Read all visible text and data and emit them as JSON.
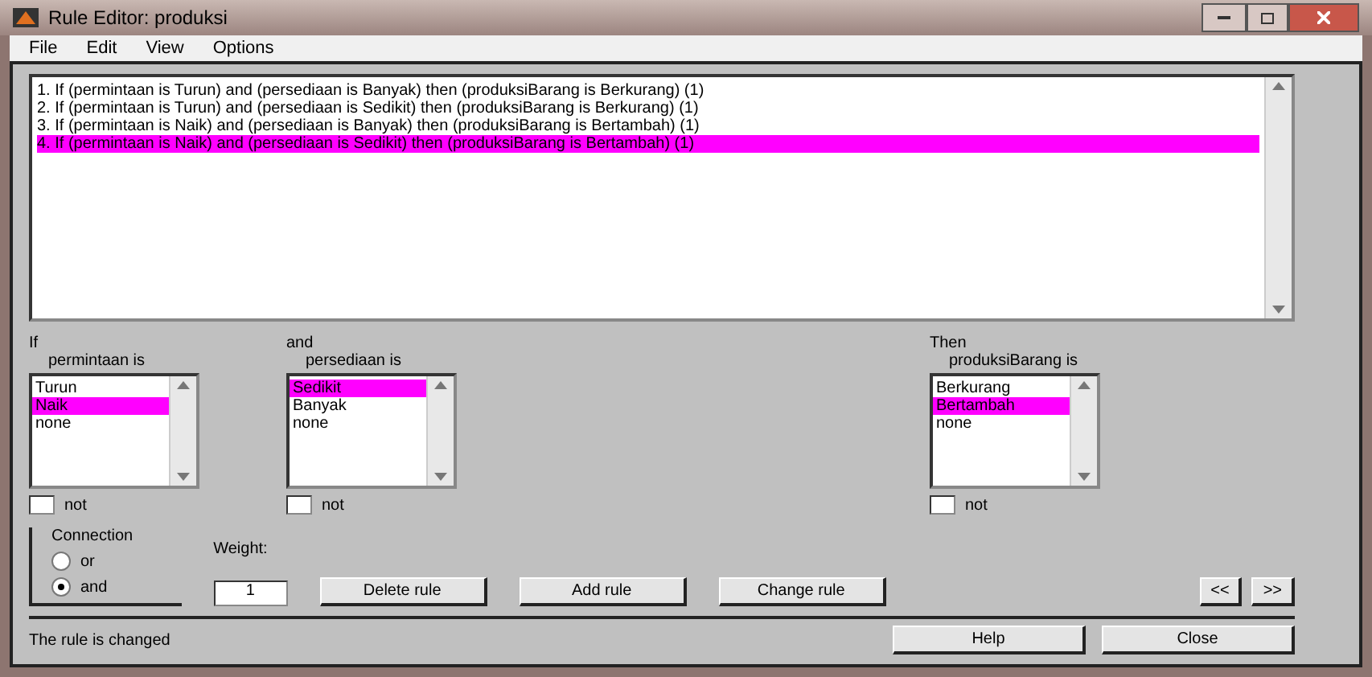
{
  "window": {
    "title": "Rule Editor: produksi"
  },
  "menu": [
    "File",
    "Edit",
    "View",
    "Options"
  ],
  "rules": [
    {
      "text": "1. If (permintaan is Turun) and (persediaan is Banyak) then (produksiBarang is Berkurang) (1)",
      "selected": false
    },
    {
      "text": "2. If (permintaan is Turun) and (persediaan is Sedikit) then (produksiBarang is Berkurang) (1)",
      "selected": false
    },
    {
      "text": "3. If (permintaan is Naik) and (persediaan is Banyak) then (produksiBarang is Bertambah) (1)",
      "selected": false
    },
    {
      "text": "4. If (permintaan is Naik) and (persediaan is Sedikit) then (produksiBarang is Bertambah) (1)",
      "selected": true
    }
  ],
  "variables": [
    {
      "prefix": "If",
      "name": "permintaan is",
      "items": [
        {
          "label": "Turun",
          "selected": false
        },
        {
          "label": "Naik",
          "selected": true
        },
        {
          "label": "none",
          "selected": false
        }
      ],
      "not_label": "not",
      "not_checked": false
    },
    {
      "prefix": "and",
      "name": "persediaan is",
      "items": [
        {
          "label": "Sedikit",
          "selected": true
        },
        {
          "label": "Banyak",
          "selected": false
        },
        {
          "label": "none",
          "selected": false
        }
      ],
      "not_label": "not",
      "not_checked": false
    },
    {
      "prefix": "Then",
      "name": "produksiBarang is",
      "items": [
        {
          "label": "Berkurang",
          "selected": false
        },
        {
          "label": "Bertambah",
          "selected": true
        },
        {
          "label": "none",
          "selected": false
        }
      ],
      "not_label": "not",
      "not_checked": false
    }
  ],
  "connection": {
    "title": "Connection",
    "options": [
      {
        "label": "or",
        "selected": false
      },
      {
        "label": "and",
        "selected": true
      }
    ]
  },
  "weight": {
    "label": "Weight:",
    "value": "1"
  },
  "buttons": [
    "Delete rule",
    "Add rule",
    "Change rule"
  ],
  "nav_buttons": [
    "<<",
    ">>"
  ],
  "status": "The rule is changed",
  "footer_buttons": [
    "Help",
    "Close"
  ]
}
